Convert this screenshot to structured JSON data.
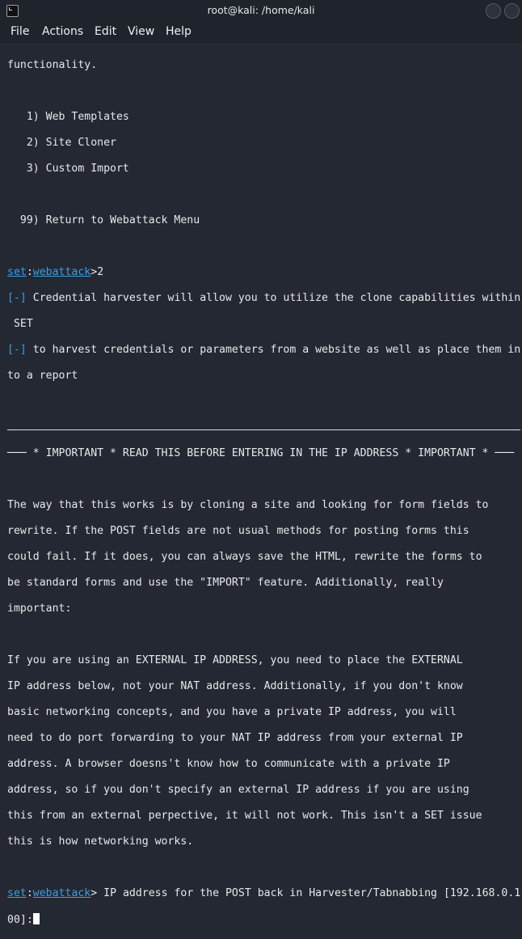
{
  "window": {
    "title": "root@kali: /home/kali"
  },
  "menu": [
    "File",
    "Actions",
    "Edit",
    "View",
    "Help"
  ],
  "terminal": {
    "intro": "functionality.",
    "options": [
      "   1) Web Templates",
      "   2) Site Cloner",
      "   3) Custom Import"
    ],
    "return_option": "  99) Return to Webattack Menu",
    "prompt_set": "set",
    "prompt_sep": ":",
    "prompt_module": "webattack",
    "prompt_gt": ">",
    "input1": "2",
    "info_tag": "[-]",
    "info1a": " Credential harvester will allow you to utilize the clone capabilities within",
    "info1b": " SET",
    "info2a": " to harvest credentials or parameters from a website as well as place them in",
    "info2b": "to a report",
    "important": "─── * IMPORTANT * READ THIS BEFORE ENTERING IN THE IP ADDRESS * IMPORTANT * ───",
    "para1": [
      "The way that this works is by cloning a site and looking for form fields to",
      "rewrite. If the POST fields are not usual methods for posting forms this",
      "could fail. If it does, you can always save the HTML, rewrite the forms to",
      "be standard forms and use the \"IMPORT\" feature. Additionally, really",
      "important:"
    ],
    "para2": [
      "If you are using an EXTERNAL IP ADDRESS, you need to place the EXTERNAL",
      "IP address below, not your NAT address. Additionally, if you don't know",
      "basic networking concepts, and you have a private IP address, you will",
      "need to do port forwarding to your NAT IP address from your external IP",
      "address. A browser doesns't know how to communicate with a private IP",
      "address, so if you don't specify an external IP address if you are using",
      "this from an external perpective, it will not work. This isn't a SET issue",
      "this is how networking works."
    ],
    "final_prompt_a": " IP address for the POST back in Harvester/Tabnabbing [192.168.0.1",
    "final_prompt_b": "00]:"
  }
}
